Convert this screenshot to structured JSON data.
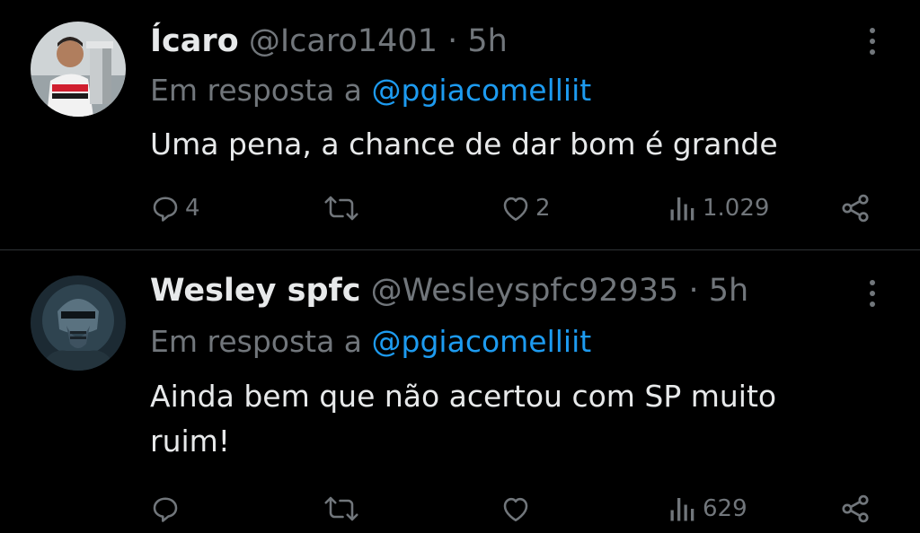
{
  "tweets": [
    {
      "name": "Ícaro",
      "handle": "@Icaro1401",
      "separator": "·",
      "time": "5h",
      "reply_prefix": "Em resposta a",
      "reply_to": "@pgiacomelliit",
      "text": "Uma pena, a chance de dar bom é grande",
      "replies": "4",
      "retweets": "",
      "likes": "2",
      "views": "1.029"
    },
    {
      "name": "Wesley spfc",
      "handle": "@Wesleyspfc92935",
      "separator": "·",
      "time": "5h",
      "reply_prefix": "Em resposta a",
      "reply_to": "@pgiacomelliit",
      "text": "Ainda bem que não acertou com SP muito ruim!",
      "replies": "",
      "retweets": "",
      "likes": "",
      "views": "629"
    }
  ],
  "colors": {
    "background": "#000000",
    "primary_text": "#e7e9ea",
    "secondary_text": "#71767b",
    "link": "#1d9bf0",
    "divider": "#2f3336"
  },
  "icons": [
    "reply-icon",
    "retweet-icon",
    "like-icon",
    "views-icon",
    "share-icon",
    "more-options-icon"
  ]
}
